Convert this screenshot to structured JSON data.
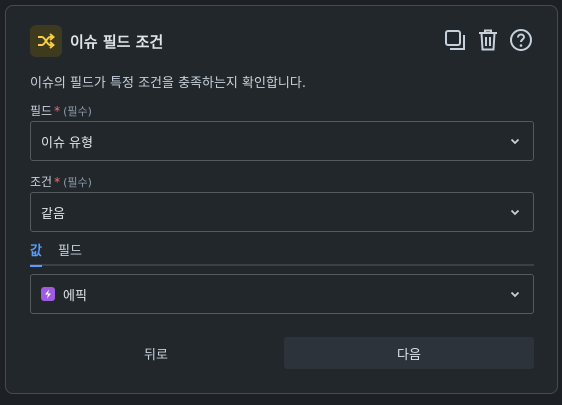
{
  "header": {
    "title": "이슈 필드 조건",
    "icon": "shuffle-icon",
    "accent": "#f5cd47",
    "actions": [
      "copy-icon",
      "trash-icon",
      "help-icon"
    ]
  },
  "description": "이슈의 필드가 특정 조건을 충족하는지 확인합니다.",
  "field": {
    "label": "필드",
    "required_mark": "*",
    "hint": "(필수)",
    "value": "이슈 유형"
  },
  "condition": {
    "label": "조건",
    "required_mark": "*",
    "hint": "(필수)",
    "value": "같음"
  },
  "tabs": [
    {
      "label": "값",
      "active": true
    },
    {
      "label": "필드",
      "active": false
    }
  ],
  "value_select": {
    "icon": "lightning-icon",
    "icon_color": "#9f5ce0",
    "value": "에픽"
  },
  "footer": {
    "back_label": "뒤로",
    "next_label": "다음"
  }
}
